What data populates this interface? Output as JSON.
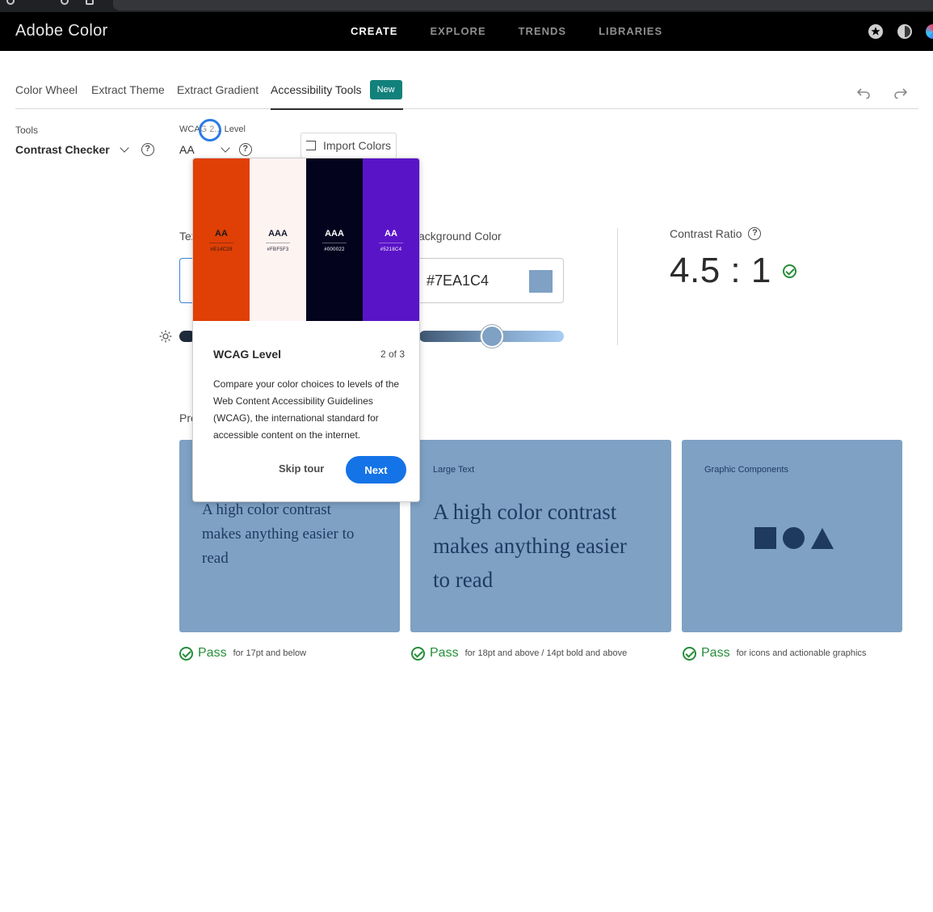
{
  "app": {
    "brand": "Adobe Color",
    "nav": [
      {
        "label": "CREATE",
        "active": true
      },
      {
        "label": "EXPLORE",
        "active": false
      },
      {
        "label": "TRENDS",
        "active": false
      },
      {
        "label": "LIBRARIES",
        "active": false
      }
    ]
  },
  "tabs": {
    "color_wheel": "Color Wheel",
    "extract_theme": "Extract Theme",
    "extract_gradient": "Extract Gradient",
    "accessibility_tools": "Accessibility Tools",
    "new_badge": "New"
  },
  "tools": {
    "label": "Tools",
    "selected": "Contrast Checker",
    "help": "?"
  },
  "wcag": {
    "label": "WCAG 2.1 Level",
    "selected": "AA",
    "help": "?"
  },
  "import_button": "Import Colors",
  "text_color": {
    "label_visible": "Tex"
  },
  "background_color": {
    "label_visible": "ackground Color",
    "value": "#7EA1C4",
    "swatch": "#7ea1c4"
  },
  "contrast": {
    "label": "Contrast Ratio",
    "help": "?",
    "value": "4.5 : 1"
  },
  "preview": {
    "label_visible": "Pre",
    "cards": [
      {
        "title": "",
        "text": "A high color contrast makes anything easier to read"
      },
      {
        "title": "Large Text",
        "text": "A high color contrast makes anything easier to read"
      },
      {
        "title": "Graphic Components"
      }
    ],
    "results": [
      {
        "status": "Pass",
        "desc": "for 17pt and below"
      },
      {
        "status": "Pass",
        "desc": "for 18pt and above / 14pt bold and above"
      },
      {
        "status": "Pass",
        "desc": "for icons and actionable graphics"
      }
    ]
  },
  "tour": {
    "swatches": [
      {
        "color": "#e03f05",
        "level": "AA",
        "hex": "#E14C29",
        "text_color": "#1a1a1a"
      },
      {
        "color": "#fdf4f2",
        "level": "AAA",
        "hex": "#FBF5F3",
        "text_color": "#1a1a2e"
      },
      {
        "color": "#03031e",
        "level": "AAA",
        "hex": "#000022",
        "text_color": "#ffffff"
      },
      {
        "color": "#5a14c8",
        "level": "AA",
        "hex": "#5218C4",
        "text_color": "#ffffff"
      }
    ],
    "title": "WCAG Level",
    "step": "2 of 3",
    "body": "Compare your color choices to levels of the Web Content Accessibility Guidelines (WCAG), the international standard for accessible content on the internet.",
    "skip": "Skip tour",
    "next": "Next"
  },
  "colors": {
    "accent_blue": "#1473e6",
    "pass_green": "#268e3a",
    "teal_badge": "#12817b",
    "preview_bg": "#7ea1c4",
    "preview_fg": "#1f3a5f"
  }
}
